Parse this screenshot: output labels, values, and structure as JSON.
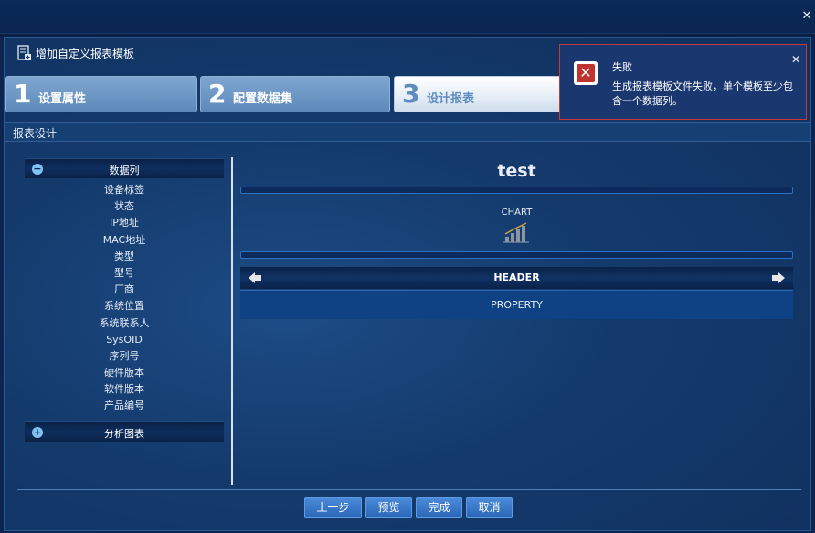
{
  "window": {
    "close_icon": "close-icon"
  },
  "dialog": {
    "title": "增加自定义报表模板",
    "icon": "report-template-icon"
  },
  "steps": [
    {
      "number": "1",
      "label": "设置属性",
      "active": false
    },
    {
      "number": "2",
      "label": "配置数据集",
      "active": false
    },
    {
      "number": "3",
      "label": "设计报表",
      "active": true
    }
  ],
  "section": {
    "title": "报表设计"
  },
  "left_panel": {
    "data_columns": {
      "label": "数据列",
      "icon": "collapse-icon",
      "items": [
        "设备标签",
        "状态",
        "IP地址",
        "MAC地址",
        "类型",
        "型号",
        "厂商",
        "系统位置",
        "系统联系人",
        "SysOID",
        "序列号",
        "硬件版本",
        "软件版本",
        "产品编号"
      ]
    },
    "analysis_charts": {
      "label": "分析图表",
      "icon": "expand-icon"
    }
  },
  "design": {
    "title": "test",
    "chart_label": "CHART",
    "chart_icon": "bar-chart-icon",
    "header_label": "HEADER",
    "property_label": "PROPERTY"
  },
  "footer": {
    "prev": "上一步",
    "preview": "预览",
    "finish": "完成",
    "cancel": "取消"
  },
  "toast": {
    "title": "失败",
    "message": "生成报表模板文件失败，单个模板至少包含一个数据列。",
    "icon": "error-icon",
    "close_icon": "close-icon"
  },
  "colors": {
    "background": "#0d2450",
    "step_active": "#ffffff",
    "step_inactive": "#6b94c4",
    "toast_border": "#c83838",
    "error_icon": "#c0332e"
  }
}
